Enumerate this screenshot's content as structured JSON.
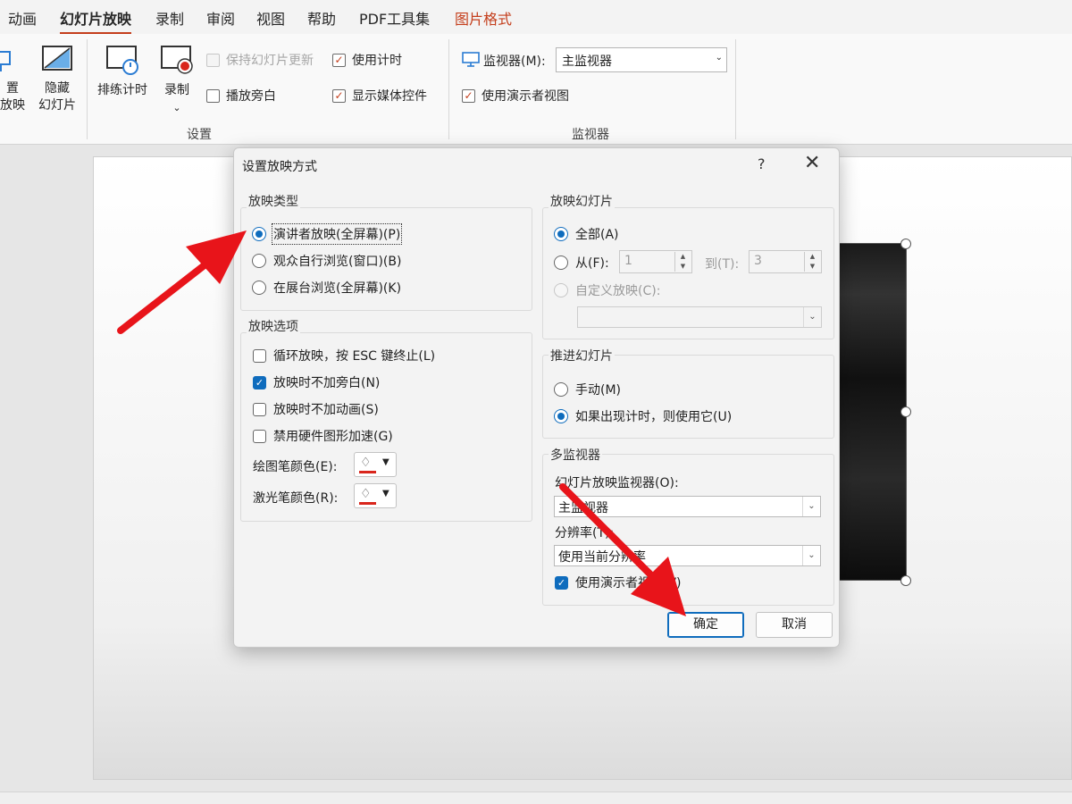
{
  "ribbon_tabs": [
    "动画",
    "幻灯片放映",
    "录制",
    "审阅",
    "视图",
    "帮助",
    "PDF工具集",
    "图片格式"
  ],
  "ribbon": {
    "setup_partial": "置",
    "setup_partial2": "放映",
    "hide_slide": [
      "隐藏",
      "幻灯片"
    ],
    "rehearse": "排练计时",
    "record": "录制",
    "keep_updated": "保持幻灯片更新",
    "play_narration": "播放旁白",
    "use_timings": "使用计时",
    "show_media": "显示媒体控件",
    "group_setup": "设置",
    "monitor_label": "监视器(M):",
    "monitor_value": "主监视器",
    "presenter_view": "使用演示者视图",
    "group_monitor": "监视器"
  },
  "dialog": {
    "title": "设置放映方式",
    "help": "?",
    "show_type": {
      "label": "放映类型",
      "options": [
        "演讲者放映(全屏幕)(P)",
        "观众自行浏览(窗口)(B)",
        "在展台浏览(全屏幕)(K)"
      ],
      "selected": 0
    },
    "show_options": {
      "label": "放映选项",
      "loop": "循环放映，按 ESC 键终止(L)",
      "no_narration": "放映时不加旁白(N)",
      "no_animation": "放映时不加动画(S)",
      "disable_hw": "禁用硬件图形加速(G)",
      "pen_color": "绘图笔颜色(E):",
      "laser_color": "激光笔颜色(R):"
    },
    "show_slides": {
      "label": "放映幻灯片",
      "all": "全部(A)",
      "from": "从(F):",
      "from_value": "1",
      "to": "到(T):",
      "to_value": "3",
      "custom": "自定义放映(C):"
    },
    "advance": {
      "label": "推进幻灯片",
      "manual": "手动(M)",
      "timings": "如果出现计时，则使用它(U)"
    },
    "multi_monitor": {
      "label": "多监视器",
      "monitor_label": "幻灯片放映监视器(O):",
      "monitor_value": "主监视器",
      "resolution_label": "分辨率(T):",
      "resolution_value": "使用当前分辨率",
      "presenter_view": "使用演示者视图(V)"
    },
    "ok": "确定",
    "cancel": "取消"
  },
  "colors": {
    "accent": "#0f6cbd",
    "ribbon_accent": "#c43e1c",
    "arrow": "#e8141a",
    "pen_color": "#d9261c"
  }
}
